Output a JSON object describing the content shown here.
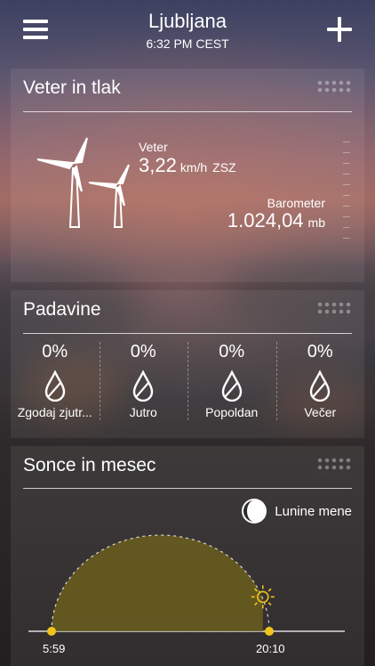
{
  "header": {
    "city": "Ljubljana",
    "time": "6:32 PM CEST",
    "menu_icon": "hamburger-menu-icon",
    "add_icon": "plus-icon"
  },
  "wind_card": {
    "title": "Veter in tlak",
    "wind_label": "Veter",
    "wind_speed": "3,22",
    "wind_unit": "km/h",
    "wind_direction": "ZSZ",
    "barometer_label": "Barometer",
    "barometer_value": "1.024,04",
    "barometer_unit": "mb"
  },
  "precip_card": {
    "title": "Padavine",
    "periods": [
      {
        "percent": "0%",
        "label": "Zgodaj zjutr..."
      },
      {
        "percent": "0%",
        "label": "Jutro"
      },
      {
        "percent": "0%",
        "label": "Popoldan"
      },
      {
        "percent": "0%",
        "label": "Večer"
      }
    ]
  },
  "sun_card": {
    "title": "Sonce in mesec",
    "moon_link": "Lunine mene",
    "sunrise": "5:59",
    "sunset": "20:10",
    "day_progress": 0.89,
    "colors": {
      "sun": "#f0c419",
      "arc_fill": "#6b5e1d"
    }
  }
}
